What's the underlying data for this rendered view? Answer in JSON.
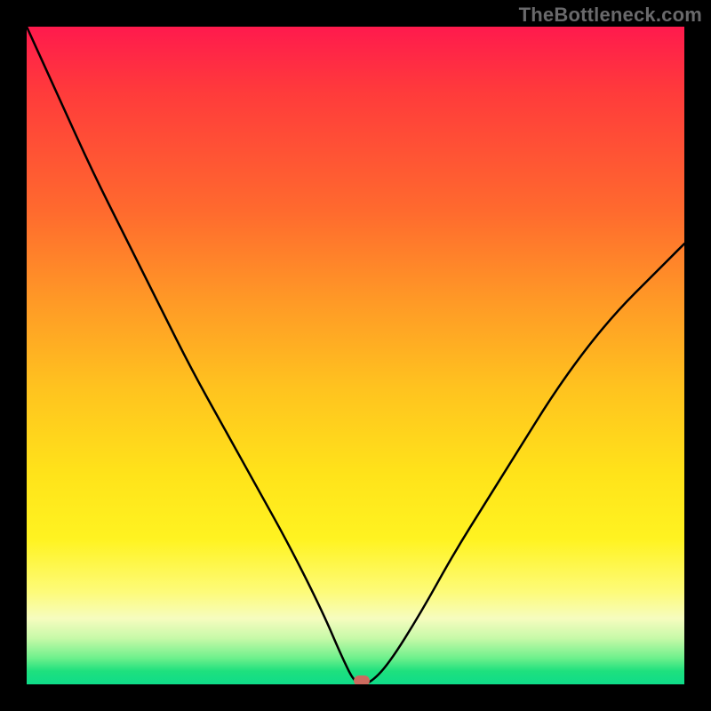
{
  "watermark": "TheBottleneck.com",
  "chart_data": {
    "type": "line",
    "title": "",
    "xlabel": "",
    "ylabel": "",
    "xlim": [
      0,
      100
    ],
    "ylim": [
      0,
      100
    ],
    "grid": false,
    "legend": false,
    "background_gradient": {
      "top": "#ff1a4d",
      "bottom": "#0fdc89",
      "meaning": "bottleneck percentage (top=100%, bottom=0%)"
    },
    "x": [
      0,
      5,
      10,
      15,
      20,
      25,
      30,
      35,
      40,
      45,
      48,
      50,
      52,
      55,
      60,
      65,
      70,
      75,
      80,
      85,
      90,
      95,
      100
    ],
    "values": [
      100,
      89,
      78,
      68,
      58,
      48,
      39,
      30,
      21,
      11,
      4,
      0,
      0,
      3,
      11,
      20,
      28,
      36,
      44,
      51,
      57,
      62,
      67
    ],
    "optimal_point": {
      "x": 51,
      "y": 0
    },
    "marker_color": "#cc6b5f"
  }
}
